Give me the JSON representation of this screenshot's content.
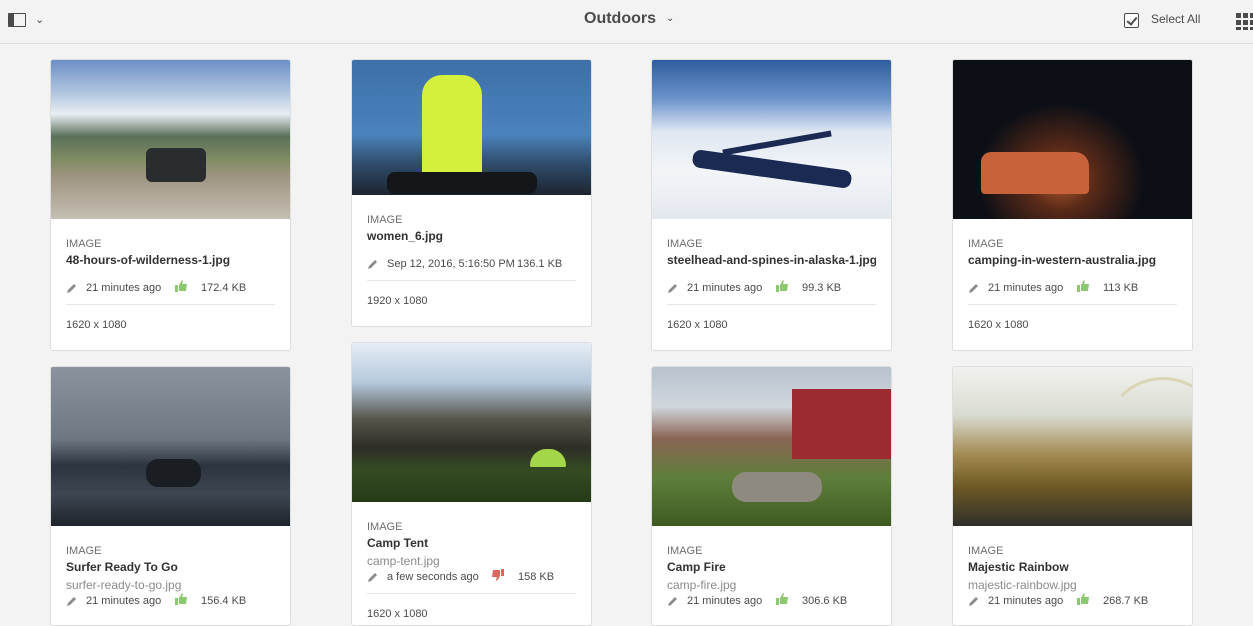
{
  "header": {
    "title": "Outdoors",
    "select_all": "Select All"
  },
  "cards": [
    {
      "type": "IMAGE",
      "name": "48-hours-of-wilderness-1.jpg",
      "modified": "21 minutes ago",
      "rating": "up",
      "size": "172.4 KB",
      "dims": "1620 x 1080"
    },
    {
      "type": "IMAGE",
      "name": "women_6.jpg",
      "modified": "Sep 12, 2016, 5:16:50 PM",
      "size": "136.1 KB",
      "dims": "1920 x 1080"
    },
    {
      "type": "IMAGE",
      "name": "steelhead-and-spines-in-alaska-1.jpg",
      "modified": "21 minutes ago",
      "rating": "up",
      "size": "99.3 KB",
      "dims": "1620 x 1080"
    },
    {
      "type": "IMAGE",
      "name": "camping-in-western-australia.jpg",
      "modified": "21 minutes ago",
      "rating": "up",
      "size": "113 KB",
      "dims": "1620 x 1080"
    },
    {
      "type": "IMAGE",
      "name": "Surfer Ready To Go",
      "file": "surfer-ready-to-go.jpg",
      "modified": "21 minutes ago",
      "rating": "up",
      "size": "156.4 KB"
    },
    {
      "type": "IMAGE",
      "name": "Camp Tent",
      "file": "camp-tent.jpg",
      "modified": "a few seconds ago",
      "rating": "down",
      "size": "158 KB",
      "dims": "1620 x 1080"
    },
    {
      "type": "IMAGE",
      "name": "Camp Fire",
      "file": "camp-fire.jpg",
      "modified": "21 minutes ago",
      "rating": "up",
      "size": "306.6 KB"
    },
    {
      "type": "IMAGE",
      "name": "Majestic Rainbow",
      "file": "majestic-rainbow.jpg",
      "modified": "21 minutes ago",
      "rating": "up",
      "size": "268.7 KB"
    }
  ],
  "colors": {
    "thumbs_up": "#8cc870",
    "thumbs_down": "#e0655c"
  }
}
